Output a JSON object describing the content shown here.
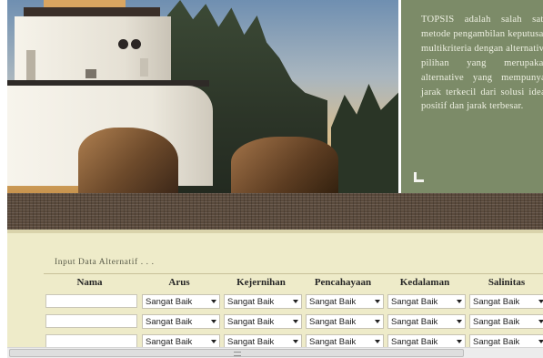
{
  "info": {
    "text": "TOPSIS adalah salah satu metode pengambilan keputusan multikriteria dengan alternative pilihan yang merupakan alternative yang mempunyai jarak terkecil dari solusi ideal positif dan jarak terbesar."
  },
  "form": {
    "title": "Input Data Alternatif . . .",
    "columns": [
      "Nama",
      "Arus",
      "Kejernihan",
      "Pencahayaan",
      "Kedalaman",
      "Salinitas"
    ],
    "rows": [
      {
        "nama": "",
        "values": [
          "Sangat Baik",
          "Sangat Baik",
          "Sangat Baik",
          "Sangat Baik",
          "Sangat Baik"
        ]
      },
      {
        "nama": "",
        "values": [
          "Sangat Baik",
          "Sangat Baik",
          "Sangat Baik",
          "Sangat Baik",
          "Sangat Baik"
        ]
      },
      {
        "nama": "",
        "values": [
          "Sangat Baik",
          "Sangat Baik",
          "Sangat Baik",
          "Sangat Baik",
          "Sangat Baik"
        ]
      }
    ]
  },
  "colors": {
    "panel": "#7c8b68",
    "content": "#eeebc9",
    "band": "#5a4a3c"
  }
}
